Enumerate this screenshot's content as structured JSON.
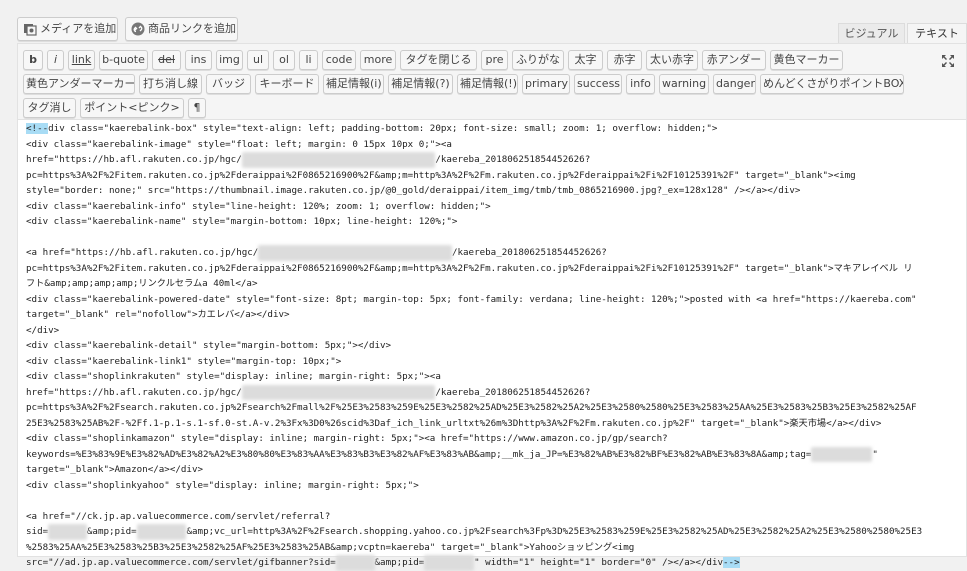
{
  "media_buttons": {
    "add_media": "メディアを追加",
    "add_product_link": "商品リンクを追加"
  },
  "tabs": {
    "visual": "ビジュアル",
    "text": "テキスト"
  },
  "quicktags": [
    "b",
    "i",
    "link",
    "b-quote",
    "del",
    "ins",
    "img",
    "ul",
    "ol",
    "li",
    "code",
    "more",
    "タグを閉じる",
    "pre",
    "ふりがな",
    "太字",
    "赤字",
    "太い赤字",
    "赤アンダー",
    "黄色マーカー",
    "黄色アンダーマーカー",
    "打ち消し線",
    "バッジ",
    "キーボード",
    "補足情報(i)",
    "補足情報(?)",
    "補足情報(!)",
    "primary",
    "success",
    "info",
    "warning",
    "danger",
    "めんどくさがりポイントBOX",
    "タグ消し",
    "ポイント<ピンク>",
    "¶"
  ],
  "icons": {
    "add_media": "media-icon",
    "add_product_link": "link-plugin-icon",
    "fullscreen": "expand-icon"
  },
  "code_lines": [
    {
      "parts": [
        {
          "t": "<!--",
          "hl": true
        },
        {
          "t": "div class=\"kaerebalink-box\" style=\"text-align: left; padding-bottom: 20px; font-size: small; zoom: 1; overflow: hidden;\">"
        }
      ]
    },
    {
      "parts": [
        {
          "t": "<div class=\"kaerebalink-image\" style=\"float: left; margin: 0 15px 10px 0;\"><a"
        }
      ]
    },
    {
      "parts": [
        {
          "t": "href=\"https://hb.afl.rakuten.co.jp/hgc/"
        },
        {
          "t": "xxxxxxxx.xxxxxxxx.xxxxxxxx.xxxxxxxx",
          "blur": true
        },
        {
          "t": "/kaereba_201806251854452626?"
        }
      ]
    },
    {
      "parts": [
        {
          "t": "pc=https%3A%2F%2Fitem.rakuten.co.jp%2Fderaippai%2F0865216900%2F&amp;m=http%3A%2F%2Fm.rakuten.co.jp%2Fderaippai%2Fi%2F10125391%2F\" target=\"_blank\"><img"
        }
      ]
    },
    {
      "parts": [
        {
          "t": "style=\"border: none;\" src=\"https://thumbnail.image.rakuten.co.jp/@0_gold/deraippai/item_img/tmb/tmb_0865216900.jpg?_ex=128x128\" /></a></div>"
        }
      ]
    },
    {
      "parts": [
        {
          "t": "<div class=\"kaerebalink-info\" style=\"line-height: 120%; zoom: 1; overflow: hidden;\">"
        }
      ]
    },
    {
      "parts": [
        {
          "t": "<div class=\"kaerebalink-name\" style=\"margin-bottom: 10px; line-height: 120%;\">"
        }
      ]
    },
    {
      "parts": [
        {
          "t": ""
        }
      ]
    },
    {
      "parts": [
        {
          "t": "<a href=\"https://hb.afl.rakuten.co.jp/hgc/"
        },
        {
          "t": "xxxxxxxx.xxxxxxxx.xxxxxxxx.xxxxxxxx",
          "blur": true
        },
        {
          "t": "/kaereba_201806251854452626?"
        }
      ]
    },
    {
      "parts": [
        {
          "t": "pc=https%3A%2F%2Fitem.rakuten.co.jp%2Fderaippai%2F0865216900%2F&amp;m=http%3A%2F%2Fm.rakuten.co.jp%2Fderaippai%2Fi%2F10125391%2F\" target=\"_blank\">マキアレイベル リ"
        }
      ]
    },
    {
      "parts": [
        {
          "t": "フト&amp;amp;amp;amp;リンクルセラムa 40ml</a>"
        }
      ]
    },
    {
      "parts": [
        {
          "t": "<div class=\"kaerebalink-powered-date\" style=\"font-size: 8pt; margin-top: 5px; font-family: verdana; line-height: 120%;\">posted with <a href=\"https://kaereba.com\""
        }
      ]
    },
    {
      "parts": [
        {
          "t": "target=\"_blank\" rel=\"nofollow\">カエレバ</a></div>"
        }
      ]
    },
    {
      "parts": [
        {
          "t": "</div>"
        }
      ]
    },
    {
      "parts": [
        {
          "t": "<div class=\"kaerebalink-detail\" style=\"margin-bottom: 5px;\"></div>"
        }
      ]
    },
    {
      "parts": [
        {
          "t": "<div class=\"kaerebalink-link1\" style=\"margin-top: 10px;\">"
        }
      ]
    },
    {
      "parts": [
        {
          "t": "<div class=\"shoplinkrakuten\" style=\"display: inline; margin-right: 5px;\"><a"
        }
      ]
    },
    {
      "parts": [
        {
          "t": "href=\"https://hb.afl.rakuten.co.jp/hgc/"
        },
        {
          "t": "xxxxxxxx.xxxxxxxx.xxxxxxxx.xxxxxxxx",
          "blur": true
        },
        {
          "t": "/kaereba_201806251854452626?"
        }
      ]
    },
    {
      "parts": [
        {
          "t": "pc=https%3A%2F%2Fsearch.rakuten.co.jp%2Fsearch%2Fmall%2F%25E3%2583%259E%25E3%2582%25AD%25E3%2582%25A2%25E3%2580%2580%25E3%2583%25AA%25E3%2583%25B3%25E3%2582%25AF"
        }
      ]
    },
    {
      "parts": [
        {
          "t": "25E3%2583%25AB%2F-%2Ff.1-p.1-s.1-sf.0-st.A-v.2%3Fx%3D0%26scid%3Daf_ich_link_urltxt%26m%3Dhttp%3A%2F%2Fm.rakuten.co.jp%2F\" target=\"_blank\">楽天市場</a></div>"
        }
      ]
    },
    {
      "parts": [
        {
          "t": "<div class=\"shoplinkamazon\" style=\"display: inline; margin-right: 5px;\"><a href=\"https://www.amazon.co.jp/gp/search?"
        }
      ]
    },
    {
      "parts": [
        {
          "t": "keywords=%E3%83%9E%E3%82%AD%E3%82%A2%E3%80%80%E3%83%AA%E3%83%B3%E3%82%AF%E3%83%AB&amp;__mk_ja_JP=%E3%82%AB%E3%82%BF%E3%82%AB%E3%83%8A&amp;tag="
        },
        {
          "t": "xxxxxxxxxxx",
          "blur": true
        },
        {
          "t": "\""
        }
      ]
    },
    {
      "parts": [
        {
          "t": "target=\"_blank\">Amazon</a></div>"
        }
      ]
    },
    {
      "parts": [
        {
          "t": "<div class=\"shoplinkyahoo\" style=\"display: inline; margin-right: 5px;\">"
        }
      ]
    },
    {
      "parts": [
        {
          "t": ""
        }
      ]
    },
    {
      "parts": [
        {
          "t": "<a href=\"//ck.jp.ap.valuecommerce.com/servlet/referral?"
        }
      ]
    },
    {
      "parts": [
        {
          "t": "sid="
        },
        {
          "t": "xxxxxxx",
          "blur": true
        },
        {
          "t": "&amp;pid="
        },
        {
          "t": "xxxxxxxxx",
          "blur": true
        },
        {
          "t": "&amp;vc_url=http%3A%2F%2Fsearch.shopping.yahoo.co.jp%2Fsearch%3Fp%3D%25E3%2583%259E%25E3%2582%25AD%25E3%2582%25A2%25E3%2580%2580%25E3"
        }
      ]
    },
    {
      "parts": [
        {
          "t": "%2583%25AA%25E3%2583%25B3%25E3%2582%25AF%25E3%2583%25AB&amp;vcptn=kaereba\" target=\"_blank\">Yahooショッピング<img"
        }
      ]
    },
    {
      "parts": [
        {
          "t": "src=\"//ad.jp.ap.valuecommerce.com/servlet/gifbanner?sid="
        },
        {
          "t": "xxxxxxx",
          "blur": true
        },
        {
          "t": "&amp;pid="
        },
        {
          "t": "xxxxxxxxx",
          "blur": true
        },
        {
          "t": "\" width=\"1\" height=\"1\" border=\"0\" /></a></div"
        },
        {
          "t": "-->",
          "hl": true
        }
      ]
    }
  ]
}
